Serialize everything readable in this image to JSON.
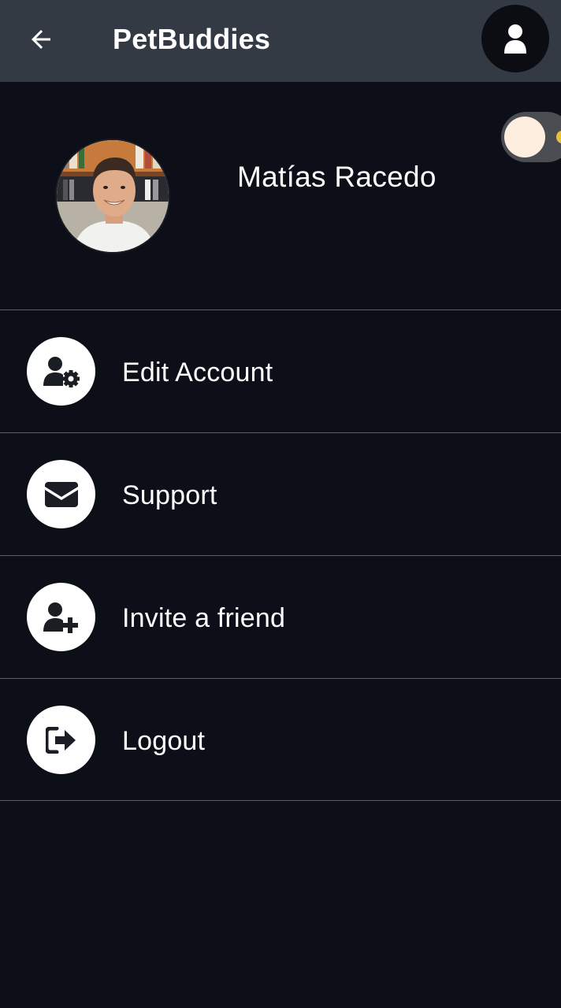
{
  "header": {
    "back_icon": "arrow-left-icon",
    "title": "PetBuddies",
    "profile_icon": "user-icon"
  },
  "profile": {
    "name": "Matías Racedo",
    "avatar": "profile-photo",
    "toggle_icon": "sun-icon"
  },
  "menu": {
    "items": [
      {
        "label": "Edit Account",
        "icon": "user-gear-icon"
      },
      {
        "label": "Support",
        "icon": "envelope-icon"
      },
      {
        "label": "Invite a friend",
        "icon": "user-plus-icon"
      },
      {
        "label": "Logout",
        "icon": "logout-icon"
      }
    ]
  },
  "colors": {
    "header_bg": "#343a44",
    "page_bg": "#0c0f18",
    "icon_circle": "#ffffff",
    "divider": "#5c5f66"
  }
}
